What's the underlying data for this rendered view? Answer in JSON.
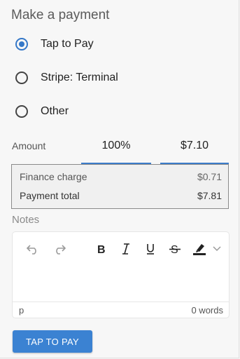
{
  "title": "Make a payment",
  "payment_methods": [
    {
      "label": "Tap to Pay",
      "selected": true
    },
    {
      "label": "Stripe: Terminal",
      "selected": false
    },
    {
      "label": "Other",
      "selected": false
    }
  ],
  "amount": {
    "label": "Amount",
    "percent": "100%",
    "value": "$7.10"
  },
  "summary": {
    "finance_charge_label": "Finance charge",
    "finance_charge_value": "$0.71",
    "payment_total_label": "Payment total",
    "payment_total_value": "$7.81"
  },
  "notes": {
    "label": "Notes",
    "toolbar_icons": [
      "undo-icon",
      "redo-icon",
      "bold-icon",
      "italic-icon",
      "underline-icon",
      "strikethrough-icon",
      "highlight-icon",
      "chevron-down-icon"
    ],
    "path": "p",
    "word_count": "0 words"
  },
  "pay_button": "TAP TO PAY",
  "colors": {
    "accent": "#3b82d2",
    "radio_selected": "#3578c8"
  }
}
